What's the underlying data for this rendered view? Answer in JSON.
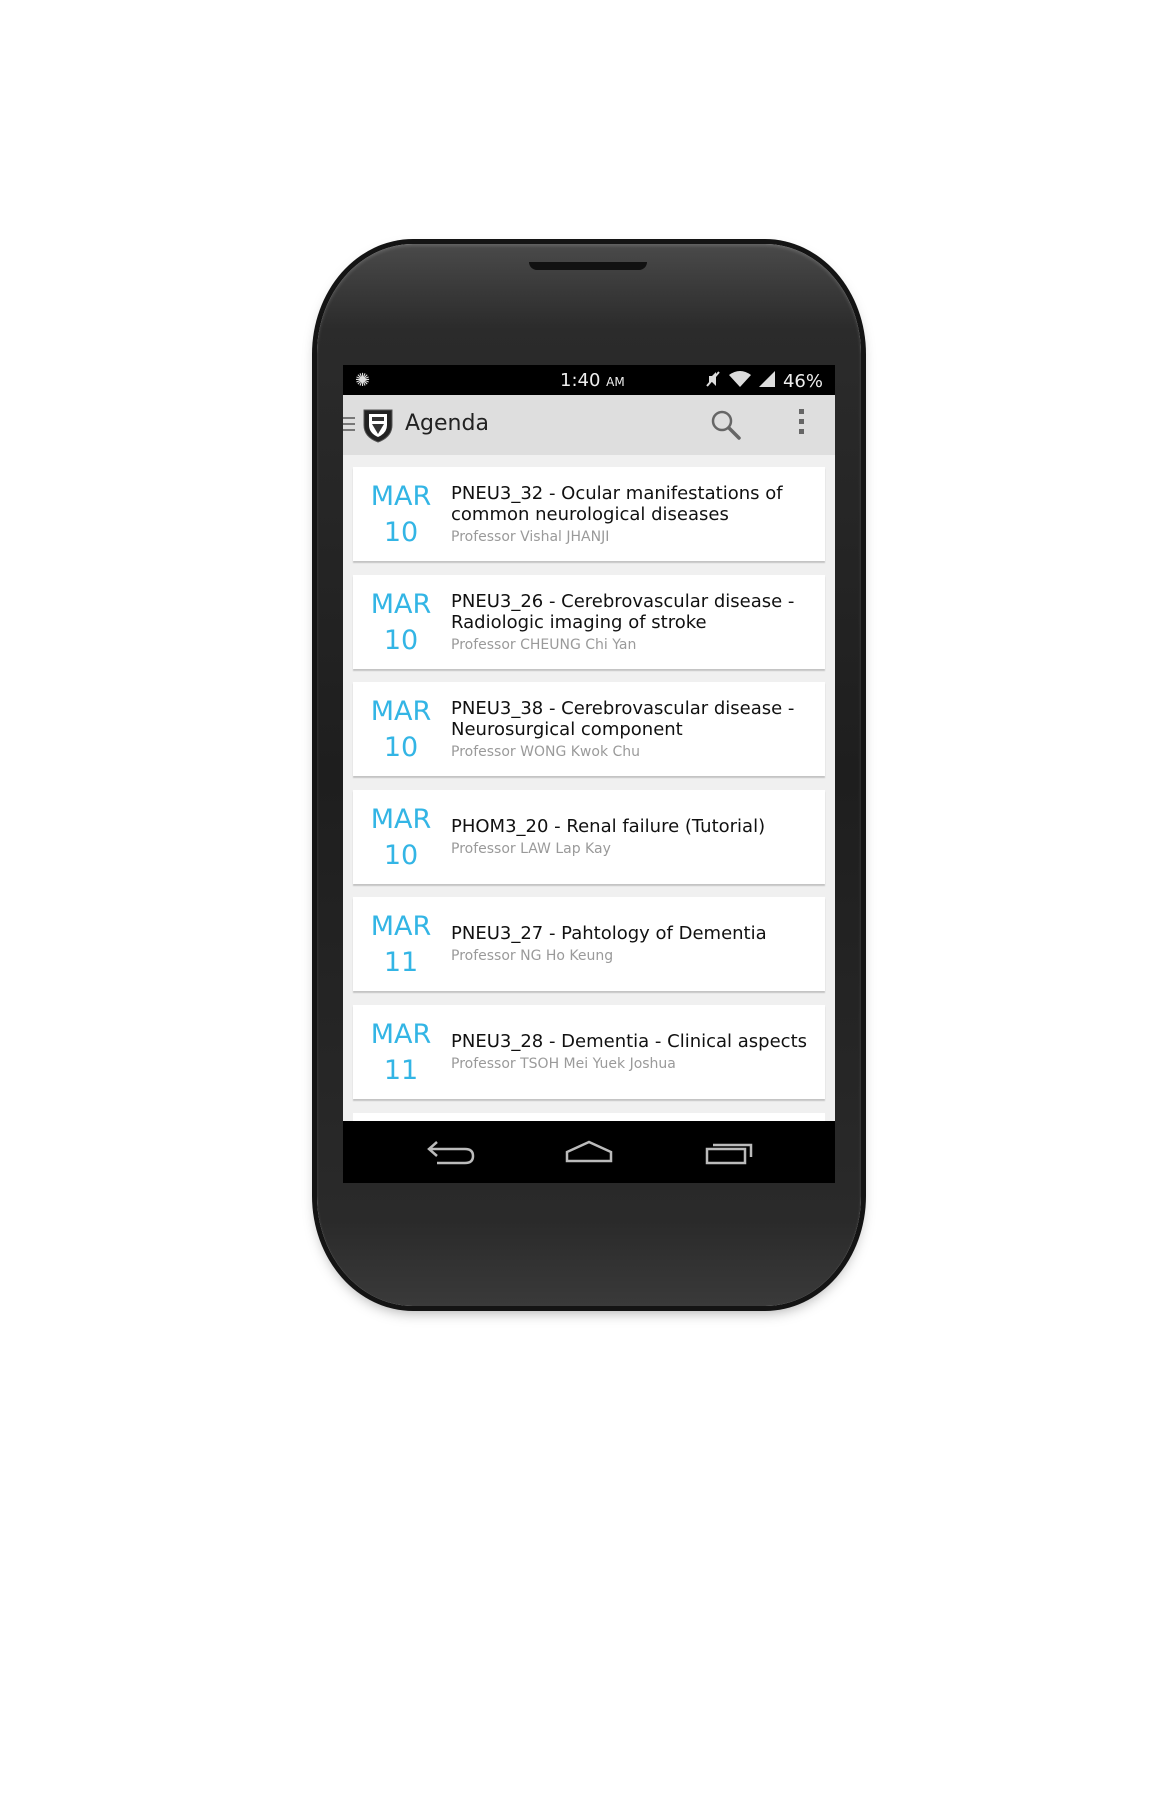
{
  "status_bar": {
    "time": "1:40",
    "ampm": "AM",
    "battery": "46%",
    "icons": [
      "brightness-icon",
      "mute-icon",
      "wifi-icon",
      "signal-icon"
    ]
  },
  "action_bar": {
    "title": "Agenda",
    "icons": [
      "drawer-icon",
      "app-logo-icon",
      "search-icon",
      "overflow-menu-icon"
    ]
  },
  "agenda": {
    "items": [
      {
        "month": "MAR",
        "day": "10",
        "title": "PNEU3_32 - Ocular manifestations of common neurological diseases",
        "professor": "Professor Vishal JHANJI"
      },
      {
        "month": "MAR",
        "day": "10",
        "title": "PNEU3_26 - Cerebrovascular disease - Radiologic imaging of stroke",
        "professor": "Professor CHEUNG Chi Yan"
      },
      {
        "month": "MAR",
        "day": "10",
        "title": "PNEU3_38 - Cerebrovascular disease - Neurosurgical component",
        "professor": "Professor WONG Kwok Chu"
      },
      {
        "month": "MAR",
        "day": "10",
        "title": "PHOM3_20 - Renal failure (Tutorial)",
        "professor": "Professor LAW Lap Kay"
      },
      {
        "month": "MAR",
        "day": "11",
        "title": "PNEU3_27 - Pahtology of Dementia",
        "professor": "Professor NG Ho Keung"
      },
      {
        "month": "MAR",
        "day": "11",
        "title": "PNEU3_28 - Dementia - Clinical aspects",
        "professor": "Professor TSOH Mei Yuek Joshua"
      }
    ]
  },
  "nav_bar": {
    "icons": [
      "back-icon",
      "home-icon",
      "recent-apps-icon"
    ]
  },
  "colors": {
    "accent": "#33b5e5",
    "action_bar": "#dedede",
    "list_background": "#f0f0f0"
  }
}
